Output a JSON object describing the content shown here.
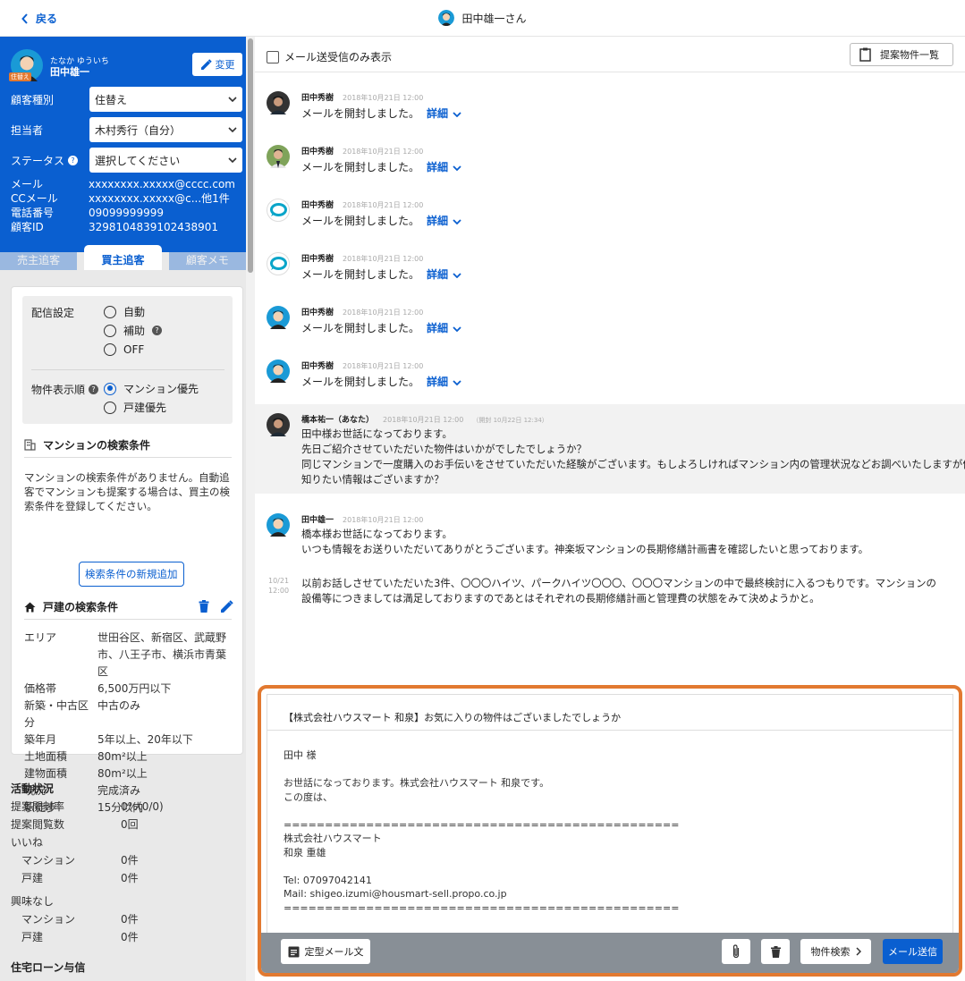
{
  "topbar": {
    "back_label": "戻る",
    "customer_title": "田中雄一さん"
  },
  "customer": {
    "kana": "たなか ゆういち",
    "name": "田中雄一",
    "badge": "住替え",
    "change_label": "変更",
    "fields": [
      {
        "label": "顧客種別",
        "value": "住替え"
      },
      {
        "label": "担当者",
        "value": "木村秀行（自分）"
      },
      {
        "label": "ステータス",
        "value": "選択してください"
      }
    ],
    "info": [
      {
        "label": "メール",
        "value": "xxxxxxxx.xxxxx@cccc.com"
      },
      {
        "label": "CCメール",
        "value": "xxxxxxxx.xxxxx@c...他1件"
      },
      {
        "label": "電話番号",
        "value": "09099999999"
      },
      {
        "label": "顧客ID",
        "value": "3298104839102438901"
      }
    ],
    "tabs": [
      "売主追客",
      "買主追客",
      "顧客メモ"
    ]
  },
  "delivery": {
    "label": "配信設定",
    "options": [
      "自動",
      "補助",
      "OFF"
    ],
    "order_label": "物件表示順",
    "order_options": [
      "マンション優先",
      "戸建優先"
    ]
  },
  "mansion": {
    "title": "マンションの検索条件",
    "empty_text": "マンションの検索条件がありません。自動追客でマンションも提案する場合は、買主の検索条件を登録してください。",
    "add_button": "検索条件の新規追加"
  },
  "house": {
    "title": "戸建の検索条件",
    "rows": [
      {
        "k": "エリア",
        "v": "世田谷区、新宿区、武蔵野市、八王子市、横浜市青葉区"
      },
      {
        "k": "価格帯",
        "v": "6,500万円以下"
      },
      {
        "k": "新築・中古区分",
        "v": "中古のみ"
      },
      {
        "k": "築年月",
        "v": "5年以上、20年以下"
      },
      {
        "k": "土地面積",
        "v": "80m²以上"
      },
      {
        "k": "建物面積",
        "v": "80m²以上"
      },
      {
        "k": "現況",
        "v": "完成済み"
      },
      {
        "k": "駅徒歩",
        "v": "15分以内"
      }
    ]
  },
  "activity": {
    "title": "活動状況",
    "rows": [
      {
        "k": "提案開封率",
        "v": "0%(0/0)"
      },
      {
        "k": "提案閲覧数",
        "v": "0回"
      },
      {
        "k": "いいね",
        "v": ""
      },
      {
        "k": "　マンション",
        "v": "0件"
      },
      {
        "k": "　戸建",
        "v": "0件"
      }
    ],
    "rows2": [
      {
        "k": "興味なし",
        "v": ""
      },
      {
        "k": "　マンション",
        "v": "0件"
      },
      {
        "k": "　戸建",
        "v": "0件"
      }
    ],
    "loan_title": "住宅ローン与信"
  },
  "thread": {
    "only_mail_label": "メール送受信のみ表示",
    "proposals_label": "提案物件一覧",
    "detail_label": "詳細",
    "events": [
      {
        "name": "田中秀樹",
        "ts": "2018年10月21日 12:00",
        "text": "メールを開封しました。"
      },
      {
        "name": "田中秀樹",
        "ts": "2018年10月21日 12:00",
        "text": "メールを開封しました。"
      },
      {
        "name": "田中秀樹",
        "ts": "2018年10月21日 12:00",
        "text": "メールを開封しました。"
      },
      {
        "name": "田中秀樹",
        "ts": "2018年10月21日 12:00",
        "text": "メールを開封しました。"
      },
      {
        "name": "田中秀樹",
        "ts": "2018年10月21日 12:00",
        "text": "メールを開封しました。"
      },
      {
        "name": "田中秀樹",
        "ts": "2018年10月21日 12:00",
        "text": "メールを開封しました。"
      }
    ],
    "my_message": {
      "name": "橋本祐一（あなた）",
      "ts": "2018年10月21日 12:00",
      "opened": "（開封 10月22日 12:34）",
      "lines": [
        "田中様お世話になっております。",
        "先日ご紹介させていただいた物件はいかがでしたでしょうか？",
        "同じマンションで一度購入のお手伝いをさせていただいた経験がございます。もしよろしければマンション内の管理状況などお調べいたしますが何か",
        "知りたい情報はございますか？"
      ]
    },
    "reply": {
      "name": "田中雄一",
      "ts": "2018年10月21日 12:00",
      "lines": [
        "橋本様お世話になっております。",
        "いつも情報をお送りいただいてありがとうございます。神楽坂マンションの長期修繕計画書を確認したいと思っております。"
      ]
    },
    "followup": {
      "date": "10/21",
      "time": "12:00",
      "lines": [
        "以前お話しさせていただいた3件、〇〇〇ハイツ、パークハイツ〇〇〇、〇〇〇マンションの中で最終検討に入るつもりです。マンションの",
        "設備等につきましては満足しておりますのであとはそれぞれの長期修繕計画と管理費の状態をみて決めようかと。"
      ]
    }
  },
  "composer": {
    "subject": "【株式会社ハウスマート 和泉】お気に入りの物件はございましたでしょうか",
    "body_lines": [
      "田中 様",
      "",
      "お世話になっております。株式会社ハウスマート 和泉です。",
      "この度は、",
      "",
      "================================================",
      "株式会社ハウスマート",
      "和泉 重雄",
      "",
      "Tel: 07097042141",
      "Mail: shigeo.izumi@housmart-sell.propo.co.jp",
      "================================================"
    ],
    "template_label": "定型メール文",
    "property_search_label": "物件検索",
    "send_label": "メール送信"
  },
  "colors": {
    "accent": "#0a5fd0",
    "highlight": "#e27930"
  }
}
